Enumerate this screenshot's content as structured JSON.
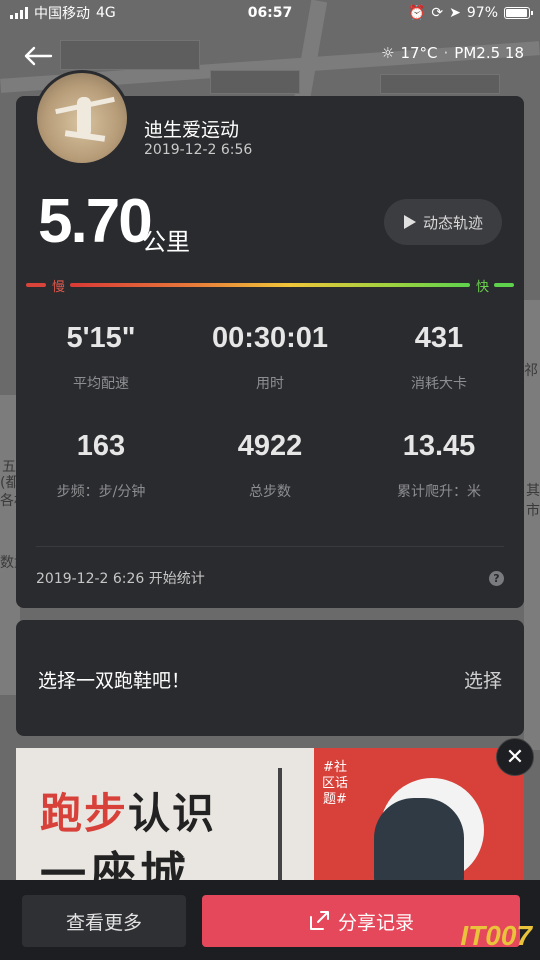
{
  "status_bar": {
    "carrier": "中国移动",
    "network": "4G",
    "time": "06:57",
    "battery": "97%",
    "battery_level": 0.97
  },
  "weather": {
    "temp": "17°C",
    "pm": "PM2.5 18"
  },
  "map_labels": [
    "五",
    "(都",
    "各林",
    "数武",
    "祁",
    "其",
    "市"
  ],
  "profile": {
    "name": "迪生爱运动",
    "datetime": "2019-12-2 6:56"
  },
  "distance": {
    "value": "5.70",
    "unit": "公里"
  },
  "playback_button": "动态轨迹",
  "pace_scale": {
    "slow": "慢",
    "fast": "快"
  },
  "stats": [
    {
      "value": "5'15\"",
      "label": "平均配速"
    },
    {
      "value": "00:30:01",
      "label": "用时"
    },
    {
      "value": "431",
      "label": "消耗大卡"
    },
    {
      "value": "163",
      "label": "步频：步/分钟"
    },
    {
      "value": "4922",
      "label": "总步数"
    },
    {
      "value": "13.45",
      "label": "累计爬升：米"
    }
  ],
  "start_info": "2019-12-2 6:26 开始统计",
  "help_icon": "?",
  "shoe": {
    "prompt": "选择一双跑鞋吧！",
    "action": "选择"
  },
  "banner": {
    "line1_red": "跑步",
    "line1_black": "认识",
    "line2": "一座城",
    "tag": "#社区话题#"
  },
  "bottom": {
    "more": "查看更多",
    "share": "分享记录"
  },
  "watermark": "IT007",
  "colors": {
    "accent": "#e5485b",
    "card": "#2a2b2e"
  }
}
